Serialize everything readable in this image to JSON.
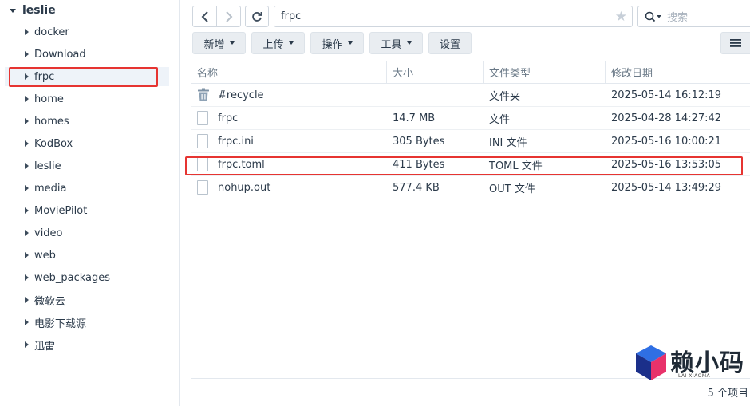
{
  "sidebar": {
    "root": "leslie",
    "items": [
      {
        "label": "docker"
      },
      {
        "label": "Download"
      },
      {
        "label": "frpc"
      },
      {
        "label": "home"
      },
      {
        "label": "homes"
      },
      {
        "label": "KodBox"
      },
      {
        "label": "leslie"
      },
      {
        "label": "media"
      },
      {
        "label": "MoviePilot"
      },
      {
        "label": "video"
      },
      {
        "label": "web"
      },
      {
        "label": "web_packages"
      },
      {
        "label": "微软云"
      },
      {
        "label": "电影下载源"
      },
      {
        "label": "迅雷"
      }
    ],
    "selected": "frpc"
  },
  "toolbar": {
    "path": "frpc",
    "search_placeholder": "搜索",
    "buttons": {
      "new": "新增",
      "upload": "上传",
      "action": "操作",
      "tools": "工具",
      "settings": "设置"
    }
  },
  "table": {
    "headers": {
      "name": "名称",
      "size": "大小",
      "type": "文件类型",
      "date": "修改日期"
    },
    "rows": [
      {
        "name": "#recycle",
        "size": "",
        "type": "文件夹",
        "date": "2025-05-14 16:12:19",
        "icon": "trash-icon"
      },
      {
        "name": "frpc",
        "size": "14.7 MB",
        "type": "文件",
        "date": "2025-04-28 14:27:42",
        "icon": "file-icon"
      },
      {
        "name": "frpc.ini",
        "size": "305 Bytes",
        "type": "INI 文件",
        "date": "2025-05-16 10:00:21",
        "icon": "file-icon"
      },
      {
        "name": "frpc.toml",
        "size": "411 Bytes",
        "type": "TOML 文件",
        "date": "2025-05-16 13:53:05",
        "icon": "file-icon"
      },
      {
        "name": "nohup.out",
        "size": "577.4 KB",
        "type": "OUT 文件",
        "date": "2025-05-14 13:49:29",
        "icon": "file-icon"
      }
    ]
  },
  "footer": {
    "count": "5 个项目"
  },
  "watermark": {
    "brand": "赖小码",
    "sub": "LAI XIAOMA"
  },
  "colors": {
    "highlight_box": "#e63431",
    "selected_bg": "#eef3f9",
    "button_bg": "#e9edf1"
  }
}
